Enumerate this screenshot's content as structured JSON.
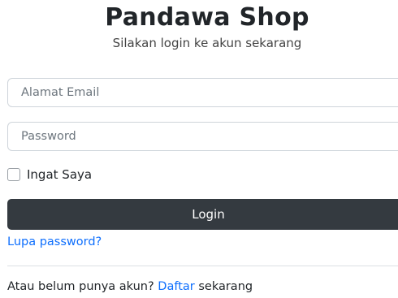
{
  "header": {
    "title": "Pandawa Shop",
    "subtitle": "Silakan login ke akun sekarang"
  },
  "form": {
    "email_placeholder": "Alamat Email",
    "email_value": "",
    "password_placeholder": "Password",
    "password_value": "",
    "remember_label": "Ingat Saya",
    "remember_checked": false,
    "login_label": "Login",
    "forgot_label": "Lupa password?"
  },
  "footer": {
    "prefix": "Atau belum punya akun?",
    "link_label": "Daftar",
    "suffix": "sekarang"
  },
  "colors": {
    "button_bg": "#343a40",
    "link": "#0d6efd"
  }
}
